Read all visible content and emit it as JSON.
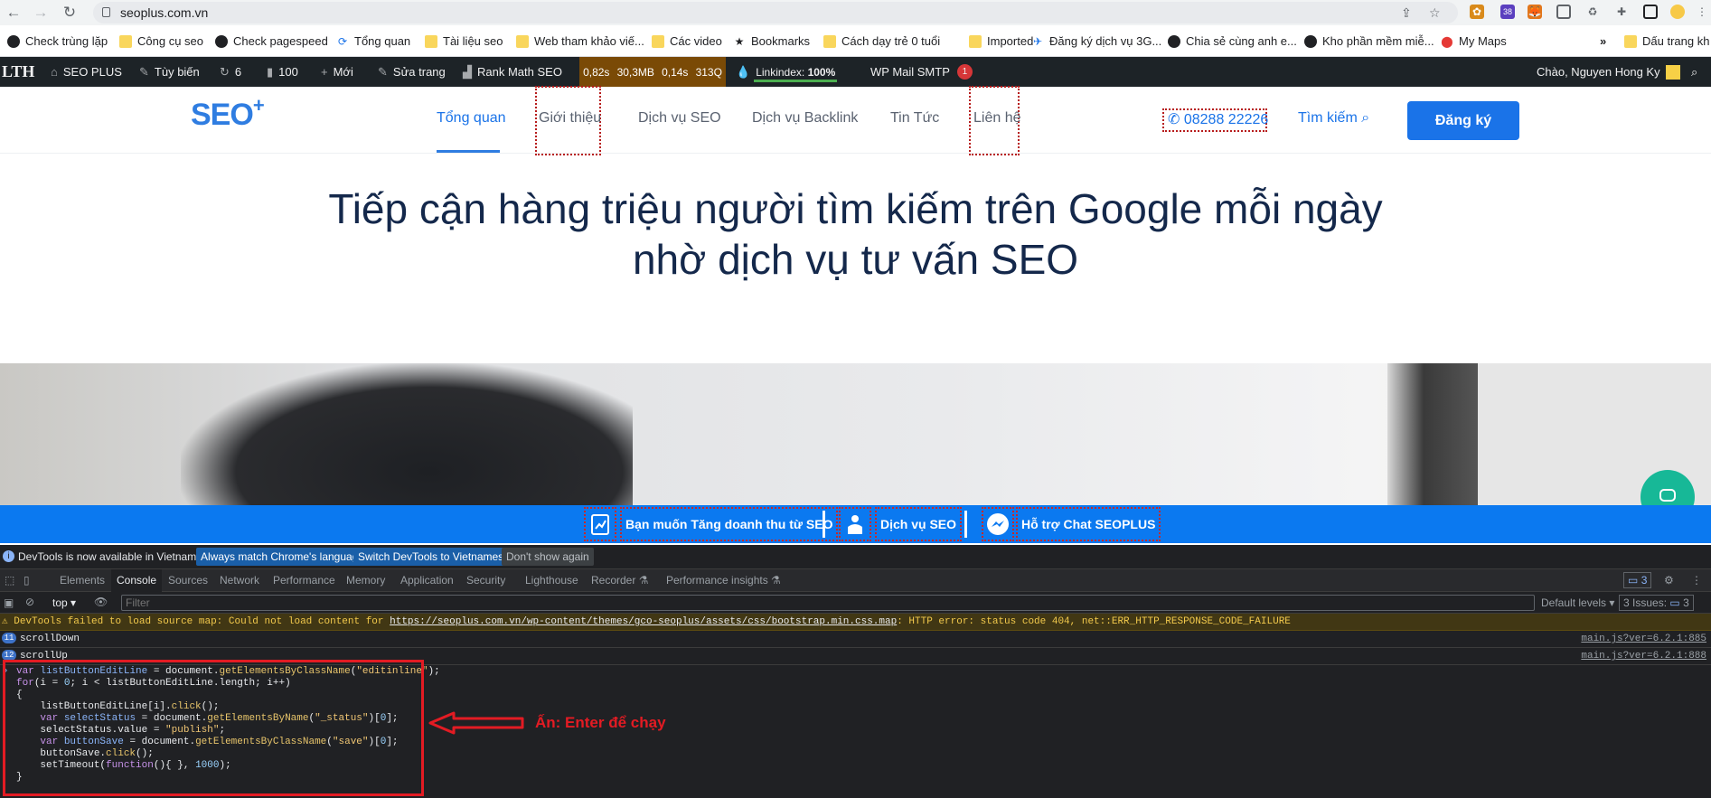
{
  "browser": {
    "url": "seoplus.com.vn",
    "extension_badge": "38",
    "bookmarks": [
      {
        "label": "Check trùng lặp",
        "icon": "globe-icon"
      },
      {
        "label": "Công cụ seo",
        "icon": "folder-icon"
      },
      {
        "label": "Check pagespeed",
        "icon": "globe-icon"
      },
      {
        "label": "Tổng quan",
        "icon": "sync-icon"
      },
      {
        "label": "Tài liệu seo",
        "icon": "folder-icon"
      },
      {
        "label": "Web tham khảo viế...",
        "icon": "folder-icon"
      },
      {
        "label": "Các video",
        "icon": "folder-icon"
      },
      {
        "label": "Bookmarks",
        "icon": "star-icon"
      },
      {
        "label": "Cách dạy trẻ 0 tuổi",
        "icon": "folder-icon"
      },
      {
        "label": "Imported",
        "icon": "folder-icon"
      },
      {
        "label": "Đăng ký dịch vụ 3G...",
        "icon": "wing-icon"
      },
      {
        "label": "Chia sẻ cùng anh e...",
        "icon": "globe-icon"
      },
      {
        "label": "Kho phần mềm miễ...",
        "icon": "github-icon"
      },
      {
        "label": "My Maps",
        "icon": "map-pin-icon"
      },
      {
        "label": "Dấu trang kh",
        "icon": "folder-icon"
      }
    ],
    "overflow": "»"
  },
  "wp_bar": {
    "logo": "LTH",
    "site": "SEO PLUS",
    "customize": "Tùy biến",
    "updates": "6",
    "comments": "100",
    "new": "Mới",
    "edit": "Sửa trang",
    "rankmath": "Rank Math SEO",
    "perf": [
      "0,82s",
      "30,3MB",
      "0,14s",
      "313Q"
    ],
    "linkindex": "Linkindex:",
    "linkindex_value": "100%",
    "smtp": "WP Mail SMTP",
    "smtp_badge": "1",
    "greeting": "Chào, Nguyen Hong Ky"
  },
  "site": {
    "logo": "SEO",
    "logo_plus": "+",
    "menu": [
      "Tổng quan",
      "Giới thiệu",
      "Dịch vụ SEO",
      "Dịch vụ Backlink",
      "Tin Tức",
      "Liên hệ"
    ],
    "phone": "08288 22226",
    "search": "Tìm kiếm",
    "signup": "Đăng ký",
    "hero_line1": "Tiếp cận hàng triệu người tìm kiếm trên Google mỗi ngày",
    "hero_line2": "nhờ dịch vụ tư vấn SEO",
    "cta": [
      "Bạn muốn Tăng doanh thu từ SEO",
      "Dịch vụ SEO",
      "Hỗ trợ Chat SEOPLUS"
    ]
  },
  "devtools": {
    "banner_text": "DevTools is now available in Vietnamese!",
    "banner_btn1": "Always match Chrome's language",
    "banner_btn2": "Switch DevTools to Vietnamese",
    "banner_btn3": "Don't show again",
    "tabs": [
      "Elements",
      "Console",
      "Sources",
      "Network",
      "Performance",
      "Memory",
      "Application",
      "Security",
      "Lighthouse",
      "Recorder ⚗",
      "Performance insights ⚗"
    ],
    "issues_badge": "3",
    "context": "top",
    "filter_placeholder": "Filter",
    "levels": "Default levels ▾",
    "issues_label": "3 Issues:",
    "issues_count": "3",
    "warning_prefix": "DevTools failed to load source map: Could not load content for",
    "warning_url": "https://seoplus.com.vn/wp-content/themes/gco-seoplus/assets/css/bootstrap.min.css.map",
    "warning_suffix": ": HTTP error: status code 404, net::ERR_HTTP_RESPONSE_CODE_FAILURE",
    "logs": [
      {
        "count": "11",
        "text": "scrollDown",
        "source": "main.js?ver=6.2.1:885"
      },
      {
        "count": "12",
        "text": "scrollUp",
        "source": "main.js?ver=6.2.1:888"
      }
    ],
    "annotation": "Ấn: Enter để chạy"
  }
}
